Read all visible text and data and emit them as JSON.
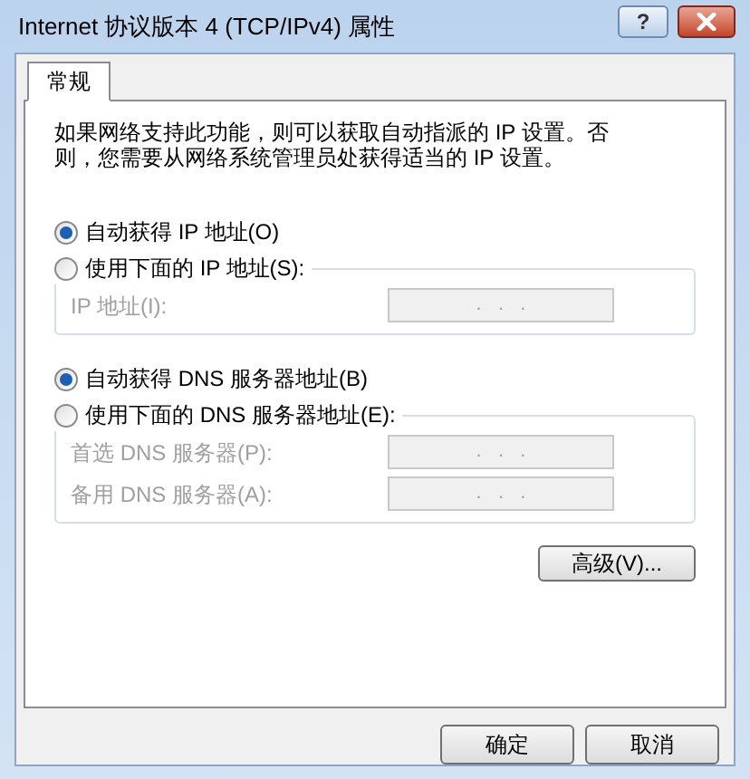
{
  "window": {
    "title": "Internet 协议版本 4 (TCP/IPv4) 属性",
    "help_button": "?"
  },
  "tabs": [
    {
      "label": "常规",
      "selected": true
    }
  ],
  "description": "如果网络支持此功能，则可以获取自动指派的 IP 设置。否则，您需要从网络系统管理员处获得适当的 IP 设置。",
  "sections": [
    {
      "radios": [
        {
          "label": "自动获得 IP 地址(O)",
          "selected": true
        },
        {
          "label": "使用下面的 IP 地址(S):",
          "selected": false
        }
      ],
      "fields": [
        {
          "label": "IP 地址(I):",
          "value": ".   .   .",
          "disabled": true
        }
      ]
    },
    {
      "radios": [
        {
          "label": "自动获得 DNS 服务器地址(B)",
          "selected": true
        },
        {
          "label": "使用下面的 DNS 服务器地址(E):",
          "selected": false
        }
      ],
      "fields": [
        {
          "label": "首选 DNS 服务器(P):",
          "value": ".   .   .",
          "disabled": true
        },
        {
          "label": "备用 DNS 服务器(A):",
          "value": ".   .   .",
          "disabled": true
        }
      ]
    }
  ],
  "advanced_button": "高级(V)...",
  "buttons": [
    "确定",
    "取消"
  ]
}
